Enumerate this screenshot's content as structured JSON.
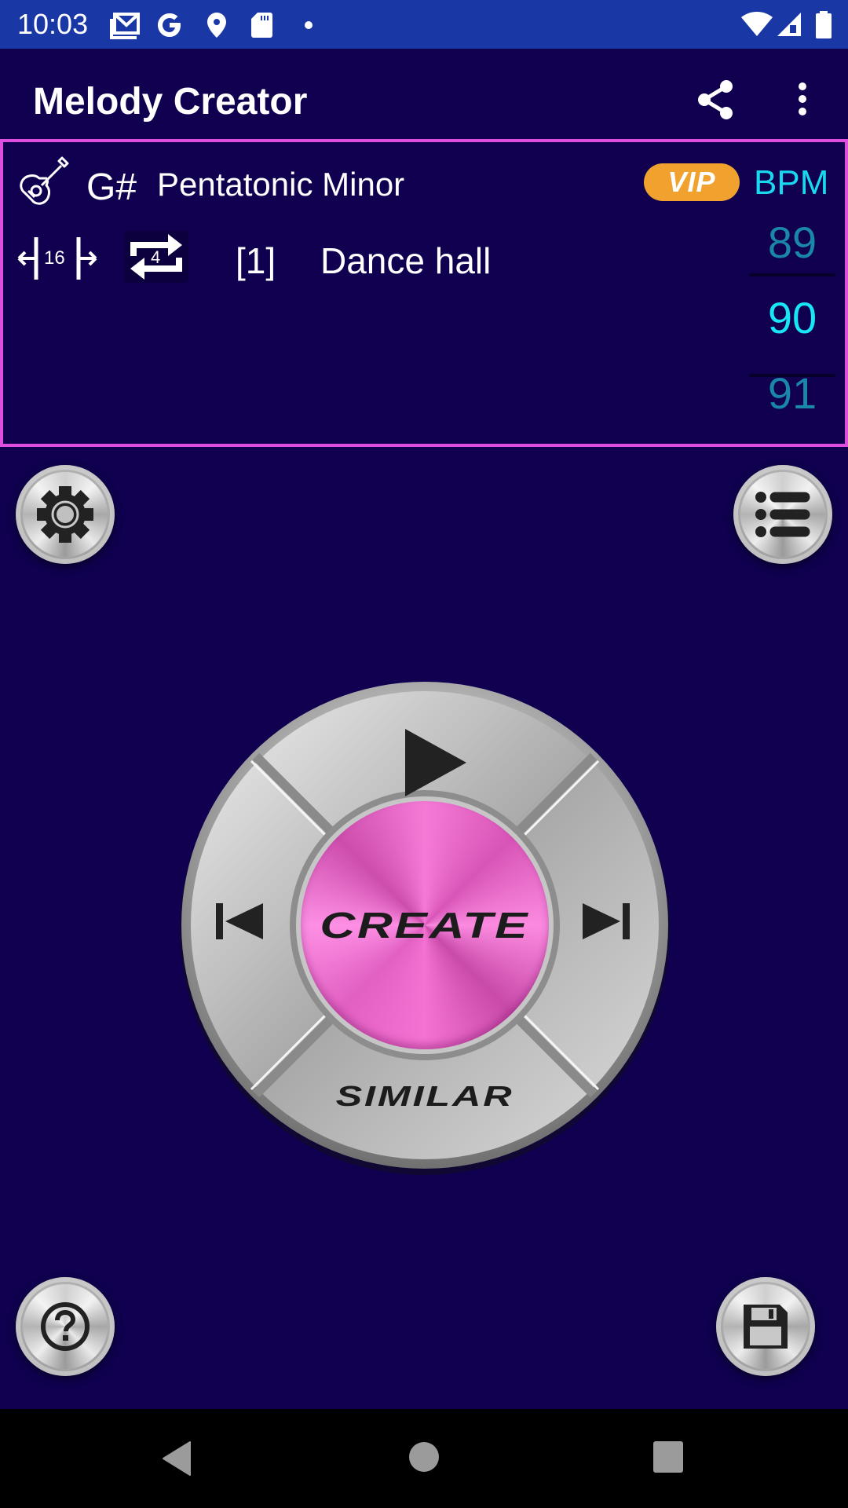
{
  "status_bar": {
    "time": "10:03",
    "notification_icons": [
      "gmail-icon",
      "google-icon",
      "location-icon",
      "sd-card-icon",
      "dot-icon"
    ],
    "system_icons": [
      "wifi-icon",
      "signal-icon",
      "battery-icon"
    ]
  },
  "app_bar": {
    "title": "Melody Creator",
    "actions": [
      "share-icon",
      "more-vert-icon"
    ]
  },
  "settings_panel": {
    "instrument_icon": "guitar-icon",
    "key": "G#",
    "scale": "Pentatonic Minor",
    "bar_length": "16",
    "repeat_count": "4",
    "pattern_number": "[1]",
    "style": "Dance hall",
    "vip_label": "VIP",
    "bpm_label": "BPM",
    "bpm_picker": {
      "previous": "89",
      "selected": "90",
      "next": "91"
    }
  },
  "controls": {
    "settings_button": "gear-icon",
    "list_button": "list-icon",
    "help_button": "help-icon",
    "save_button": "floppy-disk-icon",
    "dpad": {
      "top": "play-icon",
      "left": "skip-previous-icon",
      "right": "skip-next-icon",
      "center_label": "CREATE",
      "bottom_label": "SIMILAR"
    }
  },
  "colors": {
    "background": "#10004f",
    "status_bar": "#1a37a6",
    "panel_border": "#df4fdf",
    "accent_cyan": "#19e6f5",
    "vip_orange": "#f1a22e",
    "create_pink": "#f06ccf"
  },
  "nav_bar": {
    "buttons": [
      "back-icon",
      "home-icon",
      "recents-icon"
    ]
  }
}
